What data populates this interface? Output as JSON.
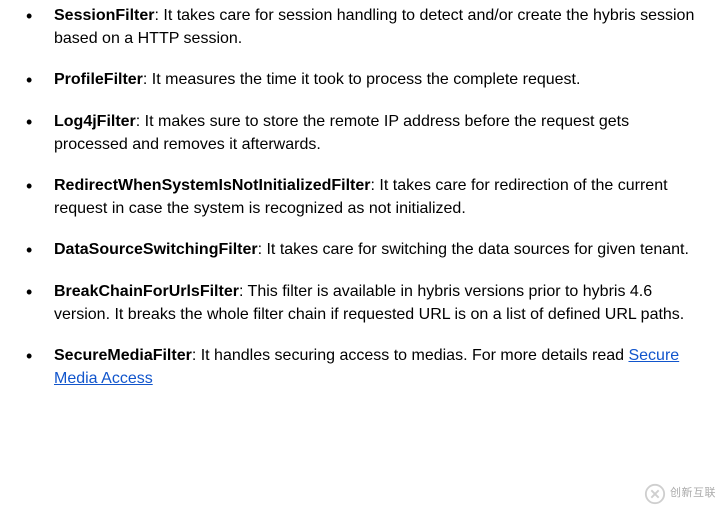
{
  "filters": [
    {
      "name": "SessionFilter",
      "desc": ": It takes care for session handling to detect and/or create the hybris session based on a HTTP session."
    },
    {
      "name": "ProfileFilter",
      "desc": ": It measures the time it took to process the complete request."
    },
    {
      "name": "Log4jFilter",
      "desc": ": It makes sure to store the remote IP address before the request gets processed and removes it afterwards."
    },
    {
      "name": "RedirectWhenSystemIsNotInitializedFilter",
      "desc": ": It takes care for redirection of the current request in case the system is recognized as not initialized."
    },
    {
      "name": "DataSourceSwitchingFilter",
      "desc": ": It takes care for switching the data sources for given tenant."
    },
    {
      "name": "BreakChainForUrlsFilter",
      "desc": ": This filter is available in hybris versions prior to hybris 4.6 version. It breaks the whole filter chain if requested URL is on a list of defined URL paths."
    },
    {
      "name": "SecureMediaFilter",
      "desc_before": ": It handles securing access to medias. For more details read ",
      "link_text": "Secure Media Access"
    }
  ],
  "watermark": "创新互联"
}
